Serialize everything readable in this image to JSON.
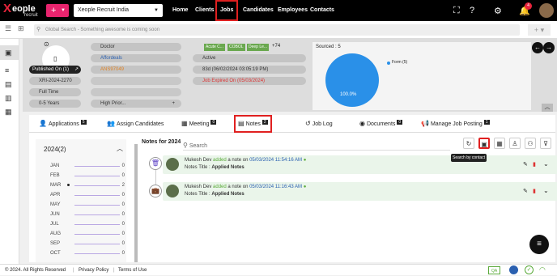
{
  "logo": {
    "main": "eople",
    "x": "X",
    "sub": "recruit"
  },
  "header": {
    "add_icon": "+",
    "org_select": "Xeople Recruit India",
    "nav": [
      "Home",
      "Clients",
      "Jobs",
      "Candidates",
      "Employees",
      "Contacts"
    ],
    "notification_count": "4"
  },
  "search": {
    "placeholder": "Global Search - Something awesome is coming soon"
  },
  "job": {
    "published": "Published On (1)",
    "code": "XRI-2024-2270",
    "type": "Full Time",
    "experience": "0-5 Years",
    "role": "Doctor",
    "company": "Affordeals",
    "contact": "ANS97049",
    "priority": "High Prior...",
    "skills": [
      "Acute C...",
      "COBOL",
      "Deep Le..."
    ],
    "skills_more": "+74",
    "status": "Active",
    "created": "83d (06/02/2024 03:05:19 PM)",
    "expired": "Job Expired On (05/03/2024)"
  },
  "sourced": {
    "title": "Sourced : 5",
    "legend": "Form (5)",
    "percent": "100.0%"
  },
  "tabs": [
    {
      "label": "Applications",
      "count": "5"
    },
    {
      "label": "Assign Candidates",
      "count": ""
    },
    {
      "label": "Meeting",
      "count": "0"
    },
    {
      "label": "Notes",
      "count": "2"
    },
    {
      "label": "Job Log",
      "count": ""
    },
    {
      "label": "Documents",
      "count": "0"
    },
    {
      "label": "Manage Job Posting",
      "count": "1"
    }
  ],
  "year": {
    "title": "2024(2)",
    "months": [
      {
        "m": "JAN",
        "v": "0"
      },
      {
        "m": "FEB",
        "v": "0"
      },
      {
        "m": "MAR",
        "v": "2"
      },
      {
        "m": "APR",
        "v": "0"
      },
      {
        "m": "MAY",
        "v": "0"
      },
      {
        "m": "JUN",
        "v": "0"
      },
      {
        "m": "JUL",
        "v": "0"
      },
      {
        "m": "AUG",
        "v": "0"
      },
      {
        "m": "SEP",
        "v": "0"
      },
      {
        "m": "OCT",
        "v": "0"
      }
    ]
  },
  "notes": {
    "title": "Notes for 2024",
    "search_placeholder": "Search",
    "tooltip": "Search by contact",
    "items": [
      {
        "author": "Mukesh Dev",
        "action": "added",
        "text": "a note on",
        "date": "05/03/2024 11:54:16 AM",
        "title_label": "Notes Title :",
        "title": "Applied Notes"
      },
      {
        "author": "Mukesh Dev",
        "action": "added",
        "text": "a note on",
        "date": "05/03/2024 11:16:43 AM",
        "title_label": "Notes Title :",
        "title": "Applied Notes"
      }
    ]
  },
  "footer": {
    "copyright": "© 2024. All Rights Reserved",
    "privacy": "Privacy Policy",
    "terms": "Terms of Use",
    "qa": "QA"
  },
  "colors": {
    "brand": "#e8246e",
    "accent": "#2a7de1",
    "highlight": "#e02020"
  }
}
